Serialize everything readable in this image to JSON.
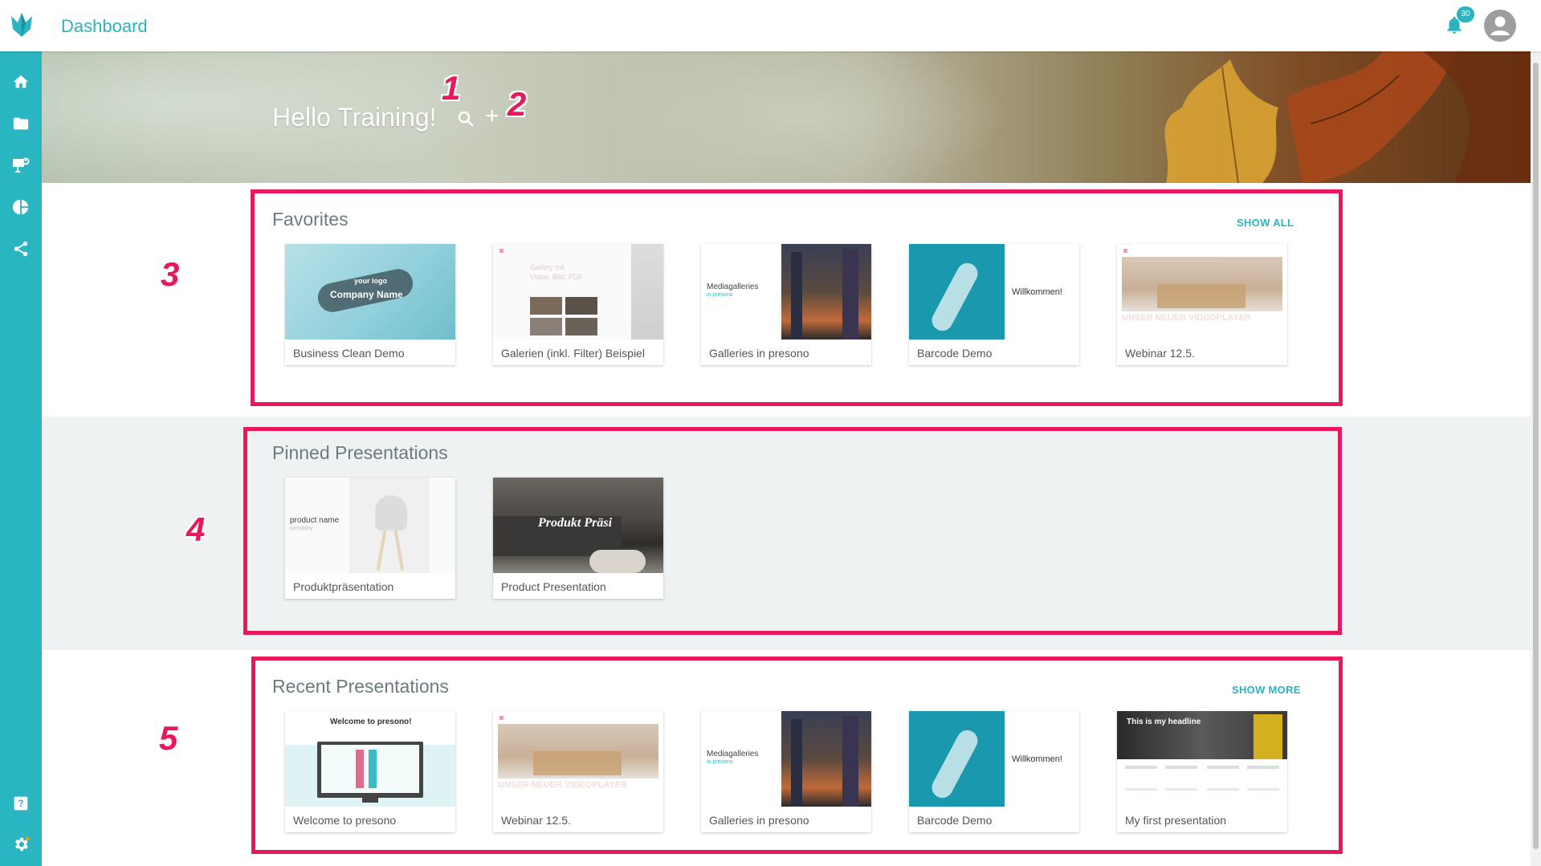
{
  "header": {
    "title": "Dashboard",
    "notification_count": "30"
  },
  "hero": {
    "greeting": "Hello Training!"
  },
  "sidebar": {
    "items": [
      {
        "icon": "home-icon"
      },
      {
        "icon": "folder-icon"
      },
      {
        "icon": "presentation-icon"
      },
      {
        "icon": "pie-chart-icon"
      },
      {
        "icon": "share-icon"
      },
      {
        "icon": "help-icon"
      },
      {
        "icon": "gear-icon"
      }
    ]
  },
  "favorites": {
    "title": "Favorites",
    "link": "SHOW ALL",
    "cards": [
      {
        "label": "Business Clean Demo",
        "thumb_text": "your logo",
        "thumb_text2": "Company Name"
      },
      {
        "label": "Galerien (inkl. Filter) Beispiel",
        "thumb_text": "Gallery mit",
        "thumb_text2": "Video, Bild, PDF"
      },
      {
        "label": "Galleries in presono",
        "thumb_text": "Mediagalleries",
        "thumb_text2": "in presono"
      },
      {
        "label": "Barcode Demo",
        "thumb_text": "Willkommen!"
      },
      {
        "label": "Webinar 12.5.",
        "thumb_text": "UNSER NEUER VIDEOPLAYER"
      }
    ]
  },
  "pinned": {
    "title": "Pinned Presentations",
    "cards": [
      {
        "label": "Produktpräsentation",
        "thumb_text": "product name",
        "thumb_text2": "company"
      },
      {
        "label": "Product Presentation",
        "thumb_text": "Produkt Präsi"
      }
    ]
  },
  "recent": {
    "title": "Recent Presentations",
    "link": "SHOW MORE",
    "cards": [
      {
        "label": "Welcome to presono",
        "thumb_text": "Welcome to presono!"
      },
      {
        "label": "Webinar 12.5.",
        "thumb_text": "UNSER NEUER VIDEOPLAYER"
      },
      {
        "label": "Galleries in presono",
        "thumb_text": "Mediagalleries",
        "thumb_text2": "in presono"
      },
      {
        "label": "Barcode Demo",
        "thumb_text": "Willkommen!"
      },
      {
        "label": "My first presentation",
        "thumb_text": "This is my headline"
      }
    ]
  },
  "annotations": [
    "1",
    "2",
    "3",
    "4",
    "5"
  ],
  "colors": {
    "accent": "#2bb3c0",
    "sidebar": "#29b6c2",
    "annotation": "#e8185a"
  }
}
